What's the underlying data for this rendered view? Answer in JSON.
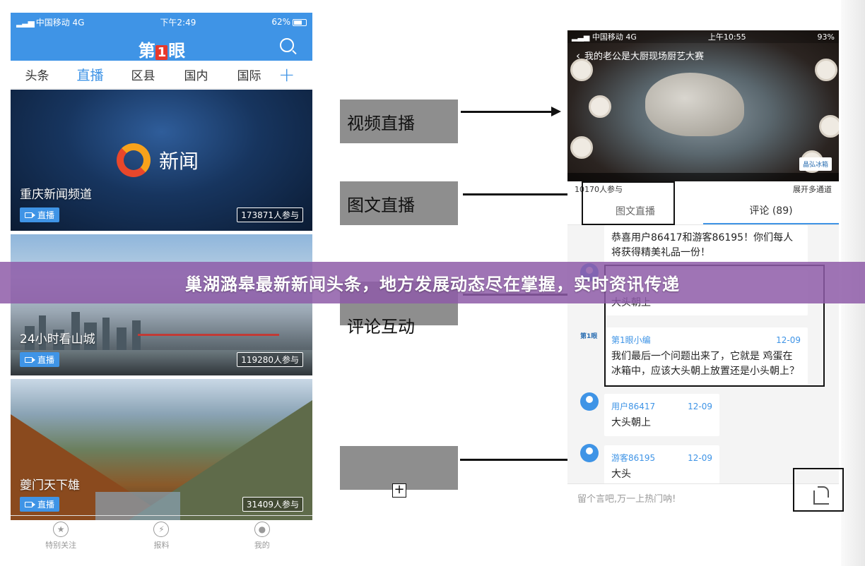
{
  "left_phone": {
    "status": {
      "carrier": "中国移动",
      "network": "4G",
      "time": "下午2:49",
      "battery": "62%"
    },
    "header": {
      "logo_pre": "第",
      "logo_num": "1",
      "logo_post": "眼"
    },
    "tabs": [
      "头条",
      "直播",
      "区县",
      "国内",
      "国际"
    ],
    "active_tab": "直播",
    "add_label": "+",
    "news_logo_text": "新闻",
    "cards": [
      {
        "title": "重庆新闻频道",
        "live": "直播",
        "count": "173871人参与"
      },
      {
        "title": "24小时看山城",
        "live": "直播",
        "count": "119280人参与"
      },
      {
        "title": "夔门天下雄",
        "live": "直播",
        "count": "31409人参与"
      }
    ],
    "bottom_nav": [
      {
        "label": "特别关注",
        "icon": "star-icon",
        "glyph": "★"
      },
      {
        "label": "报料",
        "icon": "bolt-icon",
        "glyph": "⚡"
      },
      {
        "label": "我的",
        "icon": "user-icon",
        "glyph": "●"
      }
    ]
  },
  "labels": [
    "视频直播",
    "图文直播",
    "评论互动",
    ""
  ],
  "right_phone": {
    "status": {
      "carrier": "中国移动",
      "network": "4G",
      "time": "上午10:55",
      "battery": "93%"
    },
    "video_title": "我的老公是大厨现场厨艺大赛",
    "brand": "晶弘冰箱",
    "participants": "10170人参与",
    "expand_channels": "展开多通道",
    "tabs": [
      "图文直播",
      "评论 (89)"
    ],
    "messages": [
      {
        "user": "",
        "time": "",
        "text": "恭喜用户86417和游客86195！你们每人将获得精美礼品一份！"
      },
      {
        "user": "",
        "time": "",
        "text": "大头朝上"
      },
      {
        "user": "第1眼小编",
        "time": "12-09",
        "text": "我们最后一个问题出来了，它就是 鸡蛋在冰箱中，应该大头朝上放置还是小头朝上？"
      },
      {
        "user": "用户86417",
        "time": "12-09",
        "text": "大头朝上"
      },
      {
        "user": "游客86195",
        "time": "12-09",
        "text": "大头"
      }
    ],
    "avatar_logo_text": "第1眼",
    "input_placeholder": "留个言吧,万一上热门呐!"
  },
  "banner": {
    "text": "巢湖潞皋最新新闻头条，地方发展动态尽在掌握，实时资讯传递"
  },
  "colors": {
    "primary": "#3f94e6",
    "banner": "#8e5ca8",
    "label_bg": "#8e8e8e"
  }
}
